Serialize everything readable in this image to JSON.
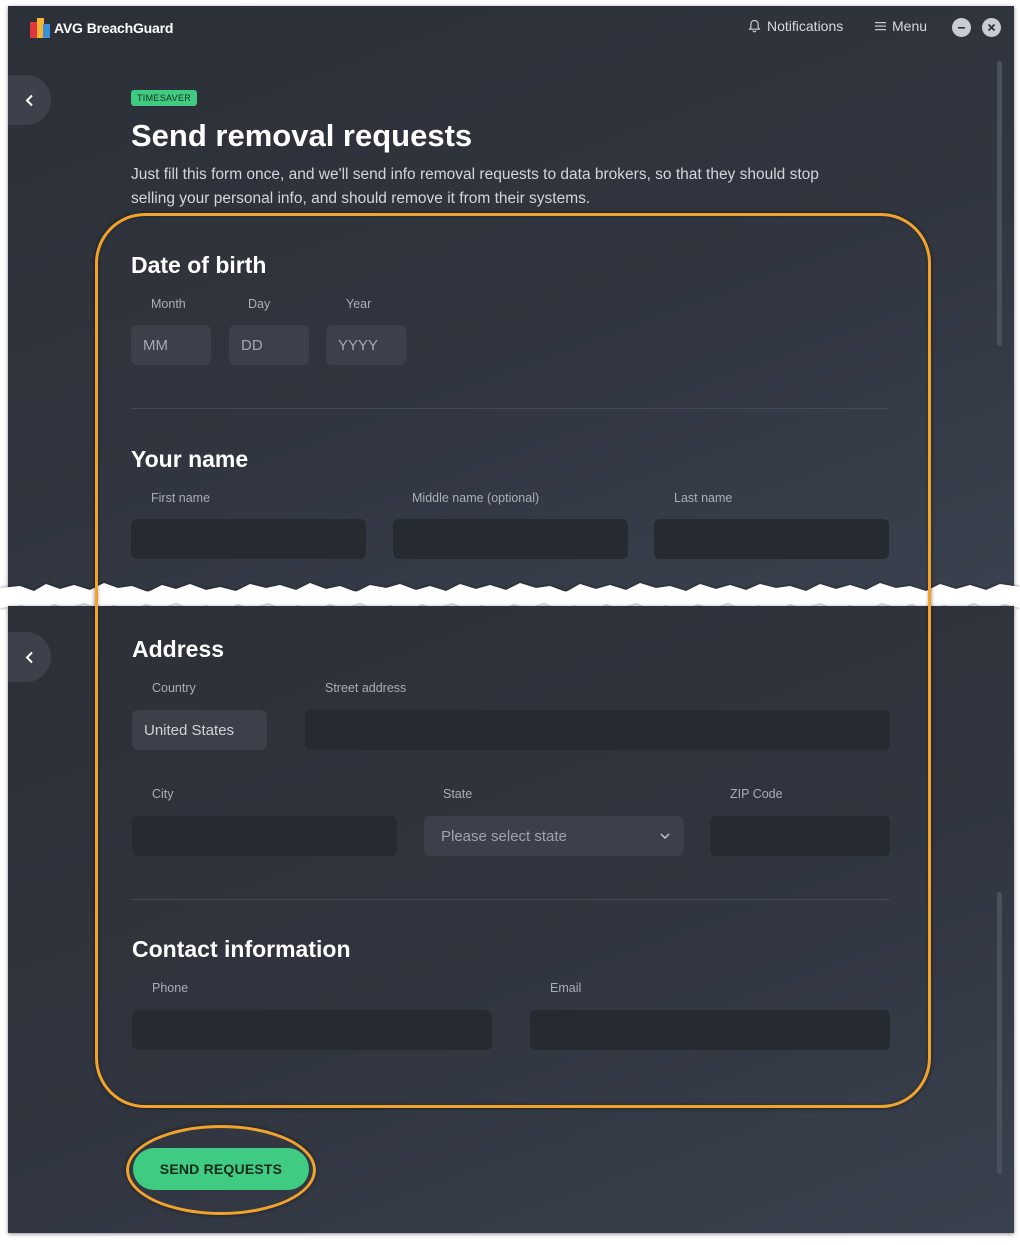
{
  "app": {
    "brand": "AVG",
    "product": "BreachGuard"
  },
  "titlebar": {
    "notifications_label": "Notifications",
    "menu_label": "Menu",
    "minimize_icon": "minus",
    "close_icon": "x"
  },
  "header": {
    "badge": "TIMESAVER",
    "title": "Send removal requests",
    "description": "Just fill this form once, and we'll send info removal requests to data brokers, so that they should stop selling your personal info, and should remove it from their systems."
  },
  "dob": {
    "title": "Date of birth",
    "month_label": "Month",
    "month_placeholder": "MM",
    "day_label": "Day",
    "day_placeholder": "DD",
    "year_label": "Year",
    "year_placeholder": "YYYY"
  },
  "name": {
    "title": "Your name",
    "first_label": "First name",
    "middle_label": "Middle name (optional)",
    "last_label": "Last name"
  },
  "address": {
    "title": "Address",
    "country_label": "Country",
    "country_value": "United States",
    "street_label": "Street address",
    "city_label": "City",
    "state_label": "State",
    "state_placeholder": "Please select state",
    "zip_label": "ZIP Code"
  },
  "contact": {
    "title": "Contact information",
    "phone_label": "Phone",
    "email_label": "Email"
  },
  "actions": {
    "send_label": "SEND REQUESTS"
  },
  "colors": {
    "accent": "#3fcb82",
    "highlight": "#f2a32b",
    "background": "#30353f",
    "field": "#262a31"
  }
}
